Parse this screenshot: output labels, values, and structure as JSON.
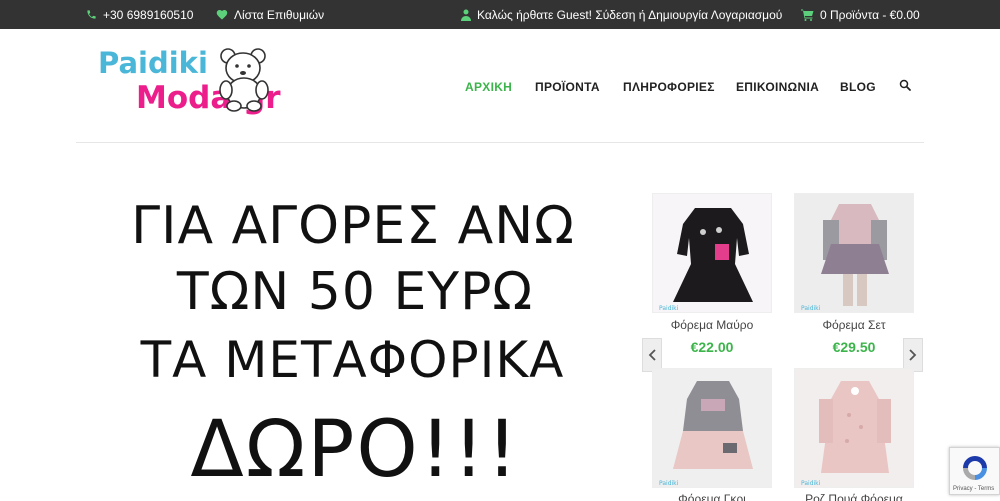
{
  "topbar": {
    "phone": "+30 6989160510",
    "wishlist": "Λίστα Επιθυμιών",
    "welcome": "Καλώς ήρθατε Guest! Σύδεση ή Δημιουργία Λογαριασμού",
    "cart": "0 Προϊόντα - €0.00"
  },
  "logo": {
    "line1": "Paidiki",
    "line2": "Moda.gr"
  },
  "nav": {
    "home": "ΑΡΧΙΚΗ",
    "products": "ΠΡΟΪΟΝΤΑ",
    "info": "ΠΛΗΡΟΦΟΡΙΕΣ",
    "contact": "ΕΠΙΚΟΙΝΩΝΙΑ",
    "blog": "BLOG"
  },
  "banner": {
    "line1": "ΓΙΑ ΑΓΟΡΕΣ ΑΝΩ",
    "line2": "ΤΩΝ 50 ΕΥΡΩ",
    "line3": "ΤΑ ΜΕΤΑΦΟΡΙΚΑ",
    "line4": "ΔΩΡΟ!!!"
  },
  "products": [
    {
      "name": "Φόρεμα Μαύρο",
      "price": "€22.00"
    },
    {
      "name": "Φόρεμα Σετ",
      "price": "€29.50"
    },
    {
      "name": "Φόρεμα Γκρι",
      "price": ""
    },
    {
      "name": "Ροζ Πουά Φόρεμα",
      "price": ""
    }
  ],
  "recaptcha": {
    "text": "Privacy - Terms"
  },
  "colors": {
    "accent": "#3cb44b",
    "topbar": "#333333",
    "logo_blue": "#4ab6d8",
    "logo_pink": "#ec1e8c"
  }
}
